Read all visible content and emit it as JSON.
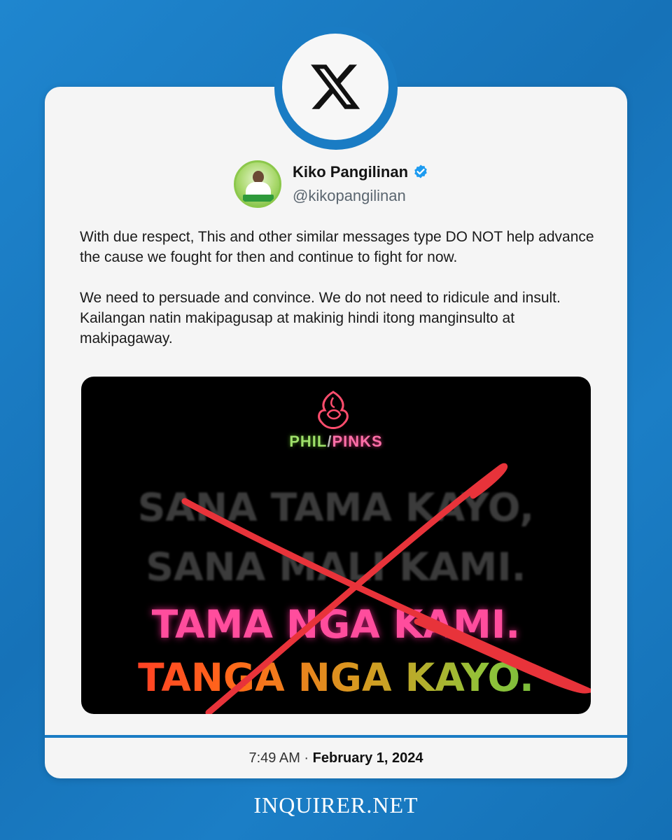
{
  "brand": {
    "logo_icon": "x-logo-icon",
    "accent": "#1a7cc4",
    "footer_text": "INQUIRER.NET"
  },
  "post": {
    "author_name": "Kiko Pangilinan",
    "author_handle": "@kikopangilinan",
    "verified_icon": "verified-badge-icon",
    "paragraph_1": "With due respect, This and other similar messages type DO NOT help advance the cause we fought for then and continue to fight for now.",
    "paragraph_2": "We need to persuade and convince. We do not need to ridicule and insult. Kailangan natin makipagusap at makinig hindi itong manginsulto at makipagaway.",
    "time": "7:49 AM",
    "separator": "·",
    "date": "February 1, 2024"
  },
  "media": {
    "logo_word_1": "PHIL",
    "logo_slash": "/",
    "logo_word_2": "PINKS",
    "line_1": "SANA TAMA KAYO,",
    "line_2": "SANA MALI KAMI.",
    "line_3": "TAMA NGA KAMI.",
    "line_4": "TANGA NGA KAYO.",
    "cross_color": "#e8333a"
  }
}
